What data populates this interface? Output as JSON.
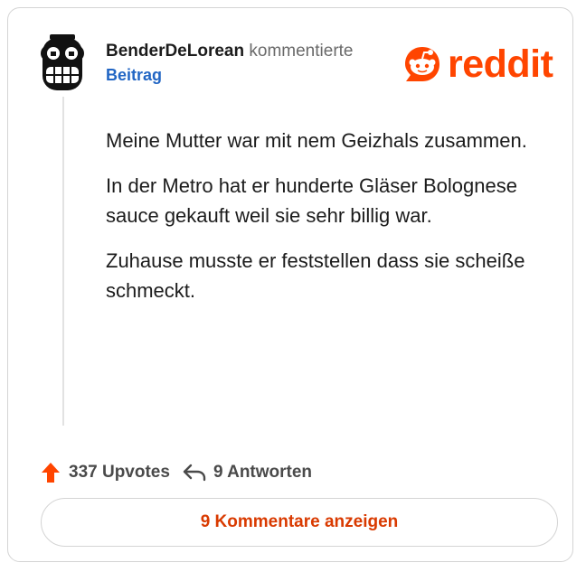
{
  "comment": {
    "username": "BenderDeLorean",
    "action": "kommentierte",
    "post_link": "Beitrag",
    "paragraphs": [
      "Meine Mutter war mit nem Geizhals zusammen.",
      "In der Metro hat er hunderte Gläser Bolognese sauce gekauft weil sie sehr billig war.",
      "Zuhause musste er feststellen dass sie scheiße schmeckt."
    ]
  },
  "brand": {
    "logo_text": "reddit",
    "color": "#ff4500"
  },
  "footer": {
    "upvotes": "337 Upvotes",
    "replies": "9 Antworten",
    "show_comments_label": "9 Kommentare anzeigen"
  },
  "icons": {
    "upvote": "upvote-arrow-icon",
    "reply": "reply-arrow-icon",
    "avatar": "robot-avatar-icon"
  }
}
